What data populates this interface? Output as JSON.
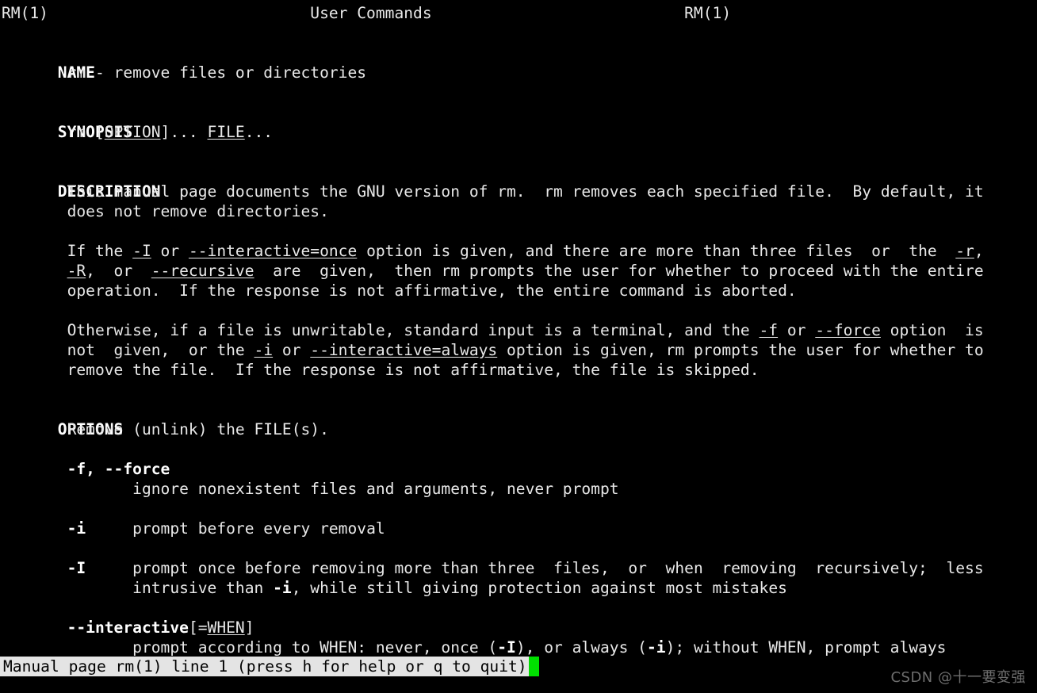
{
  "terminal": {
    "background": "#000000",
    "foreground": "#e8e8e8",
    "bold_color": "#ffffff",
    "cursor_color": "#00e000",
    "statusbar_background": "#e4e4e4",
    "statusbar_foreground": "#000000"
  },
  "header": {
    "left": "RM(1)",
    "center": "User Commands",
    "right": "RM(1)"
  },
  "sections": {
    "name": "NAME",
    "synopsis": "SYNOPSIS",
    "description": "DESCRIPTION",
    "options": "OPTIONS"
  },
  "lines": {
    "header_line": "RM(1)                            User Commands                           RM(1)",
    "name_heading": "NAME",
    "name_body": "       rm - remove files or directories",
    "synopsis_heading": "SYNOPSIS",
    "synopsis_rm": "       rm ",
    "synopsis_option_open": "[",
    "synopsis_option": "OPTION",
    "synopsis_option_close": "]... ",
    "synopsis_file": "FILE",
    "synopsis_tail": "...",
    "description_heading": "DESCRIPTION",
    "desc_l1": "       This manual page documents the GNU version of rm.  rm removes each specified file.  By default, it",
    "desc_l2": "       does not remove directories.",
    "desc_p2_a_pre": "       If the ",
    "desc_p2_a_opt1": "-I",
    "desc_p2_a_mid": " or ",
    "desc_p2_a_opt2": "--interactive=once",
    "desc_p2_a_post": " option is given, and there are more than three files  or  the  ",
    "desc_p2_a_opt3": "-r",
    "desc_p2_a_end": ",",
    "desc_p2_b_opt1": "-R",
    "desc_p2_b_mid": ",  or  ",
    "desc_p2_b_opt2": "--recursive",
    "desc_p2_b_post": "  are  given,  then rm prompts the user for whether to proceed with the entire",
    "desc_p2_c": "       operation.  If the response is not affirmative, the entire command is aborted.",
    "desc_p3_a_pre": "       Otherwise, if a file is unwritable, standard input is a terminal, and the ",
    "desc_p3_a_opt1": "-f",
    "desc_p3_a_mid": " or ",
    "desc_p3_a_opt2": "--force",
    "desc_p3_a_post": " option  is",
    "desc_p3_b_pre": "       not  given,  or the ",
    "desc_p3_b_opt1": "-i",
    "desc_p3_b_mid": " or ",
    "desc_p3_b_opt2": "--interactive=always",
    "desc_p3_b_post": " option is given, rm prompts the user for whether to",
    "desc_p3_c": "       remove the file.  If the response is not affirmative, the file is skipped.",
    "options_heading": "OPTIONS",
    "opt_intro": "       Remove (unlink) the FILE(s).",
    "opt_force_flag": "-f, --force",
    "opt_force_desc": "              ignore nonexistent files and arguments, never prompt",
    "opt_i_flag": "-i",
    "opt_i_desc": "     prompt before every removal",
    "opt_I_flag": "-I",
    "opt_I_desc_a": "     prompt once before removing more than three  files,  or  when  removing  recursively;  less",
    "opt_I_desc_b_pre": "              intrusive than ",
    "opt_I_desc_b_opt": "-i",
    "opt_I_desc_b_post": ", while still giving protection against most mistakes",
    "opt_interactive_flag": "--interactive",
    "opt_interactive_open": "[=",
    "opt_interactive_when": "WHEN",
    "opt_interactive_close": "]",
    "opt_interactive_desc_pre": "              prompt according to WHEN: never, once (",
    "opt_interactive_desc_I": "-I",
    "opt_interactive_desc_mid": "), or always (",
    "opt_interactive_desc_i": "-i",
    "opt_interactive_desc_post": "); without WHEN, prompt always"
  },
  "statusbar": {
    "text": "Manual page rm(1) line 1 (press h for help or q to quit)",
    "cursor": "block-cursor"
  },
  "watermark": {
    "text": "CSDN @十一要变强"
  }
}
